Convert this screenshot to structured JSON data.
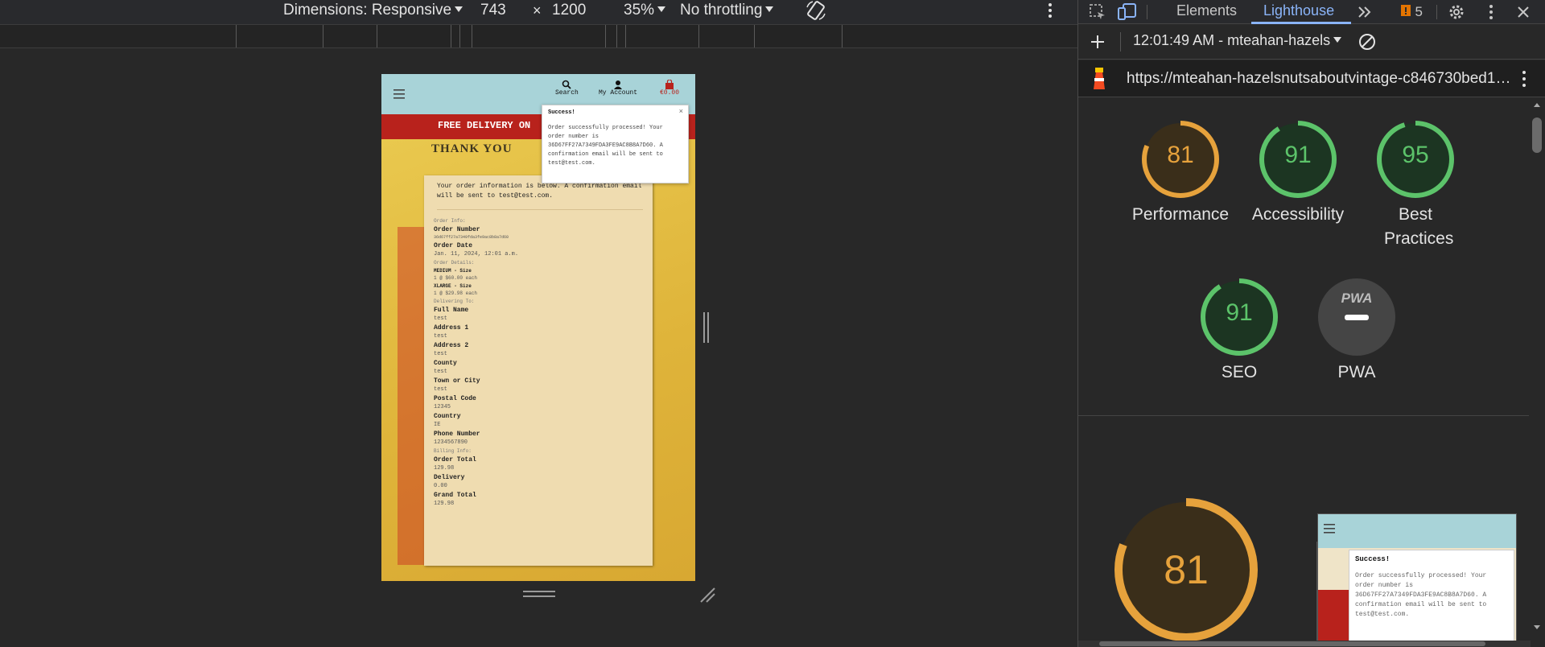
{
  "toolbar": {
    "dimensions": "Dimensions: Responsive",
    "width": "743",
    "times": "×",
    "height": "1200",
    "zoom": "35%",
    "throttle": "No throttling"
  },
  "phone": {
    "nav": {
      "search": "Search",
      "account": "My Account",
      "bag": "€0.00"
    },
    "banner": "FREE DELIVERY ON",
    "heading": "THANK YOU",
    "toast": {
      "title": "Success!",
      "body": "Order successfully processed! Your order number is 36D67FF27A7349FDA3FE9AC8B8A7D60. A confirmation email will be sent to test@test.com.",
      "close": "×"
    },
    "card": {
      "intro": "Your order information is below. A confirmation email will be sent to test@test.com.",
      "order_info": "Order Info:",
      "order_number_label": "Order Number",
      "order_number": "36d67ff27a7349fda3fe9ac8b8a7d60",
      "order_date_label": "Order Date",
      "order_date": "Jan. 11, 2024, 12:01 a.m.",
      "order_details": "Order Details:",
      "item1": "MEDIUM - Size",
      "item1_price": "1 @ $60.00 each",
      "item2": "XLARGE - Size",
      "item2_price": "1 @ $29.98 each",
      "delivering": "Delivering To:",
      "full_name_label": "Full Name",
      "full_name": "test",
      "address1_label": "Address 1",
      "address1": "test",
      "address2_label": "Address 2",
      "address2": "test",
      "county_label": "County",
      "county": "test",
      "town_label": "Town or City",
      "town": "test",
      "postal_label": "Postal Code",
      "postal": "12345",
      "country_label": "Country",
      "country": "IE",
      "phone_label": "Phone Number",
      "phone": "1234567890",
      "billing": "Billing Info:",
      "total_label": "Order Total",
      "total": "129.98",
      "delivery_label": "Delivery",
      "delivery": "0.00",
      "grand_label": "Grand Total",
      "grand": "129.98"
    }
  },
  "devtools": {
    "tabs": {
      "elements": "Elements",
      "lighthouse": "Lighthouse",
      "issues": "5"
    },
    "report": "12:01:49 AM - mteahan-hazels",
    "url": "https://mteahan-hazelsnutsaboutvintage-c846730bed1…",
    "scores": [
      {
        "label": "Performance",
        "value": "81",
        "frac": 0.81,
        "color": "#e6a23c"
      },
      {
        "label": "Accessibility",
        "value": "91",
        "frac": 0.91,
        "color": "#5cc36a"
      },
      {
        "label": "Best Practices",
        "value": "95",
        "frac": 0.95,
        "color": "#5cc36a"
      },
      {
        "label": "SEO",
        "value": "91",
        "frac": 0.91,
        "color": "#5cc36a"
      },
      {
        "label": "PWA",
        "value": "PWA",
        "frac": 0,
        "color": "#ffffff"
      }
    ],
    "big": {
      "value": "81",
      "frac": 0.81
    },
    "thumb": {
      "toast_title": "Success!",
      "toast_body": "Order successfully processed! Your order number is 36D67FF27A7349FDA3FE9AC8B8A7D60. A confirmation email will be sent to test@test.com."
    }
  }
}
